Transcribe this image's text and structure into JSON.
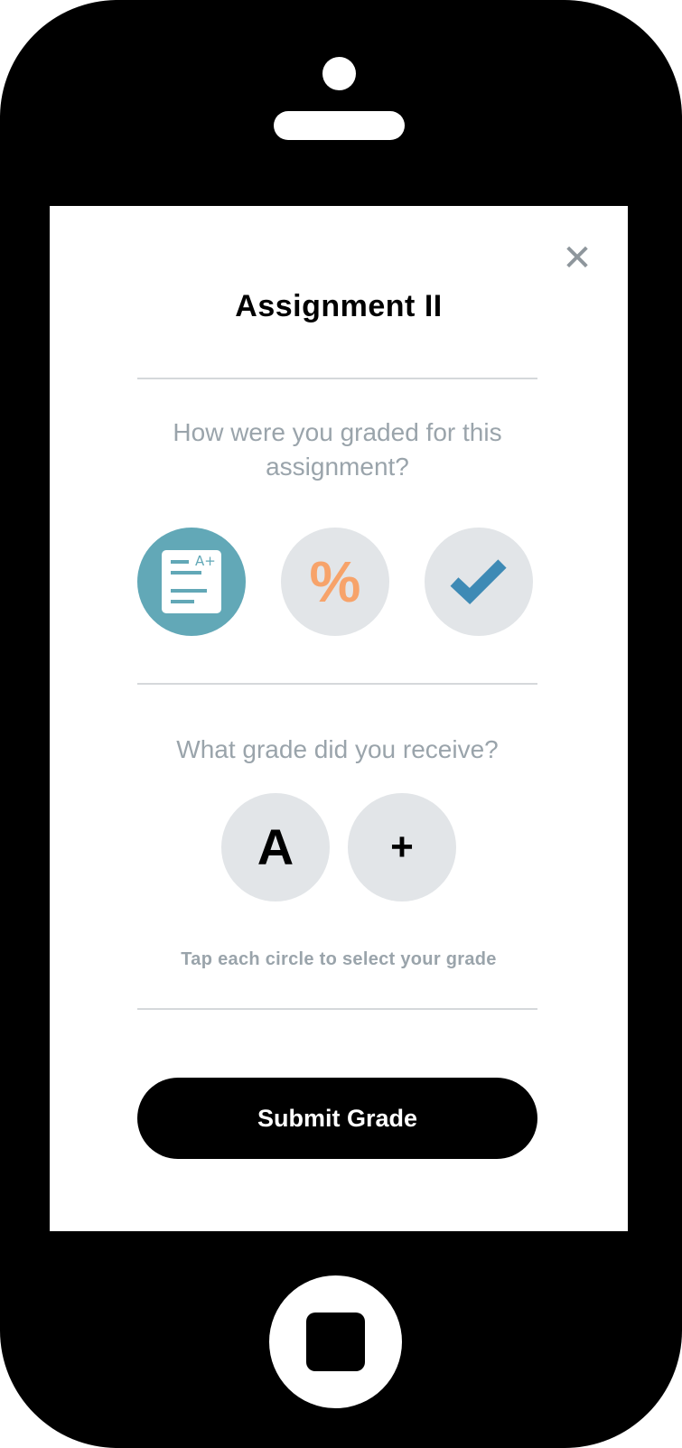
{
  "screen": {
    "title": "Assignment II",
    "close_icon": "close-icon",
    "grading_question": "How were you graded for this assignment?",
    "grading_options": [
      {
        "name": "letter-grade",
        "icon": "document-a-plus-icon",
        "selected": true,
        "label": "A+"
      },
      {
        "name": "percentage",
        "icon": "percent-icon",
        "selected": false,
        "label": "%"
      },
      {
        "name": "pass-fail",
        "icon": "checkmark-icon",
        "selected": false
      }
    ],
    "grade_question": "What grade did you receive?",
    "grade_letter": "A",
    "grade_modifier": "+",
    "hint": "Tap each circle to select your grade",
    "submit_label": "Submit Grade"
  },
  "colors": {
    "selected": "#62a8b7",
    "percent": "#f7a36a",
    "check": "#3e8ab5",
    "muted_text": "#9aa4ab",
    "circle_bg": "#e2e5e8"
  }
}
